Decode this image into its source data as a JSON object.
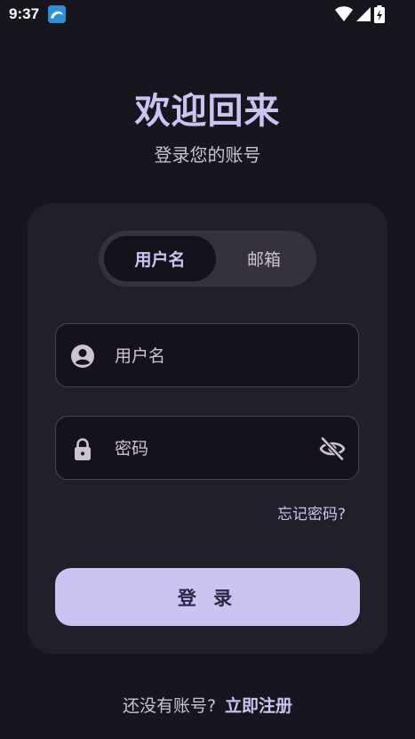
{
  "status_bar": {
    "time": "9:37",
    "icons": [
      "app-notification-icon",
      "wifi-icon",
      "cell-signal-icon",
      "battery-charging-icon"
    ]
  },
  "header": {
    "title": "欢迎回来",
    "subtitle": "登录您的账号"
  },
  "login_tabs": [
    {
      "label": "用户名",
      "selected": true
    },
    {
      "label": "邮箱",
      "selected": false
    }
  ],
  "form": {
    "username_placeholder": "用户名",
    "password_placeholder": "密码",
    "username_icon": "account-circle-icon",
    "password_icon": "lock-icon",
    "visibility_icon": "visibility-off-icon",
    "forgot_password": "忘记密码?",
    "login_button": "登 录"
  },
  "footer": {
    "prompt": "还没有账号?",
    "register_link": "立即注册"
  },
  "colors": {
    "background": "#17151d",
    "card": "#221f2a",
    "accent": "#cdc3f3",
    "field_border": "#4a4554"
  }
}
